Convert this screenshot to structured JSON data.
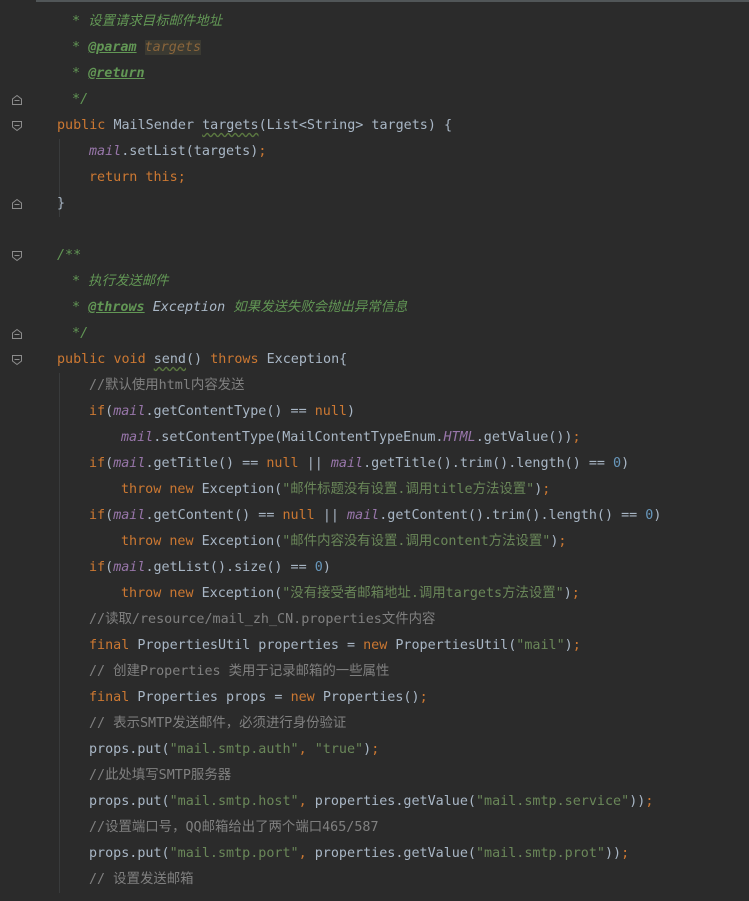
{
  "editor": {
    "lines": [
      {
        "tokens": [
          {
            "t": " * 设置请求目标邮件地址",
            "c": "t-doc"
          }
        ],
        "indent": 64
      },
      {
        "tokens": [
          {
            "t": " * ",
            "c": "t-doc"
          },
          {
            "t": "@param",
            "c": "t-doctag"
          },
          {
            "t": " ",
            "c": "t-doc"
          },
          {
            "t": "targets",
            "c": "t-docparam"
          }
        ],
        "indent": 64
      },
      {
        "tokens": [
          {
            "t": " * ",
            "c": "t-doc"
          },
          {
            "t": "@return",
            "c": "t-doctag"
          }
        ],
        "indent": 64
      },
      {
        "tokens": [
          {
            "t": " */",
            "c": "t-doc"
          }
        ],
        "indent": 64,
        "fold": "end"
      },
      {
        "tokens": [
          {
            "t": "public ",
            "c": "t-kw"
          },
          {
            "t": "MailSender ",
            "c": "t-type"
          },
          {
            "t": "targets",
            "c": "t-method t-typo"
          },
          {
            "t": "(List<String> targets) {",
            "c": "t-plain"
          }
        ],
        "indent": 57,
        "fold": "start"
      },
      {
        "tokens": [
          {
            "t": "mail",
            "c": "t-field"
          },
          {
            "t": ".setList(targets)",
            "c": "t-plain"
          },
          {
            "t": ";",
            "c": "t-semi"
          }
        ],
        "indent": 89
      },
      {
        "tokens": [
          {
            "t": "return ",
            "c": "t-kw"
          },
          {
            "t": "this",
            "c": "t-kw"
          },
          {
            "t": ";",
            "c": "t-semi"
          }
        ],
        "indent": 89
      },
      {
        "tokens": [
          {
            "t": "}",
            "c": "t-plain"
          }
        ],
        "indent": 57,
        "fold": "end"
      },
      {
        "tokens": [],
        "indent": 57
      },
      {
        "tokens": [
          {
            "t": "/**",
            "c": "t-doc"
          }
        ],
        "indent": 57,
        "fold": "start"
      },
      {
        "tokens": [
          {
            "t": " * 执行发送邮件",
            "c": "t-doc"
          }
        ],
        "indent": 64
      },
      {
        "tokens": [
          {
            "t": " * ",
            "c": "t-doc"
          },
          {
            "t": "@throws",
            "c": "t-doctag"
          },
          {
            "t": " ",
            "c": "t-doc"
          },
          {
            "t": "Exception",
            "c": "t-docref"
          },
          {
            "t": " 如果发送失败会抛出异常信息",
            "c": "t-doc"
          }
        ],
        "indent": 64
      },
      {
        "tokens": [
          {
            "t": " */",
            "c": "t-doc"
          }
        ],
        "indent": 64,
        "fold": "end"
      },
      {
        "tokens": [
          {
            "t": "public ",
            "c": "t-kw"
          },
          {
            "t": "void ",
            "c": "t-kw"
          },
          {
            "t": "send",
            "c": "t-method t-typo"
          },
          {
            "t": "() ",
            "c": "t-plain"
          },
          {
            "t": "throws ",
            "c": "t-kw"
          },
          {
            "t": "Exception{",
            "c": "t-plain"
          }
        ],
        "indent": 57,
        "fold": "start"
      },
      {
        "tokens": [
          {
            "t": "//默认使用html内容发送",
            "c": "t-comment"
          }
        ],
        "indent": 89
      },
      {
        "tokens": [
          {
            "t": "if",
            "c": "t-kw"
          },
          {
            "t": "(",
            "c": "t-plain"
          },
          {
            "t": "mail",
            "c": "t-field"
          },
          {
            "t": ".getContentType() == ",
            "c": "t-plain"
          },
          {
            "t": "null",
            "c": "t-kw"
          },
          {
            "t": ")",
            "c": "t-plain"
          }
        ],
        "indent": 89
      },
      {
        "tokens": [
          {
            "t": "mail",
            "c": "t-field"
          },
          {
            "t": ".setContentType(MailContentTypeEnum.",
            "c": "t-plain"
          },
          {
            "t": "HTML",
            "c": "t-const"
          },
          {
            "t": ".getValue())",
            "c": "t-plain"
          },
          {
            "t": ";",
            "c": "t-semi"
          }
        ],
        "indent": 121
      },
      {
        "tokens": [
          {
            "t": "if",
            "c": "t-kw"
          },
          {
            "t": "(",
            "c": "t-plain"
          },
          {
            "t": "mail",
            "c": "t-field"
          },
          {
            "t": ".getTitle() == ",
            "c": "t-plain"
          },
          {
            "t": "null ",
            "c": "t-kw"
          },
          {
            "t": "|| ",
            "c": "t-plain"
          },
          {
            "t": "mail",
            "c": "t-field"
          },
          {
            "t": ".getTitle().trim().length() == ",
            "c": "t-plain"
          },
          {
            "t": "0",
            "c": "t-num"
          },
          {
            "t": ")",
            "c": "t-plain"
          }
        ],
        "indent": 89
      },
      {
        "tokens": [
          {
            "t": "throw ",
            "c": "t-kw"
          },
          {
            "t": "new ",
            "c": "t-kw"
          },
          {
            "t": "Exception(",
            "c": "t-plain"
          },
          {
            "t": "\"邮件标题没有设置.调用title方法设置\"",
            "c": "t-str"
          },
          {
            "t": ")",
            "c": "t-plain"
          },
          {
            "t": ";",
            "c": "t-semi"
          }
        ],
        "indent": 121
      },
      {
        "tokens": [
          {
            "t": "if",
            "c": "t-kw"
          },
          {
            "t": "(",
            "c": "t-plain"
          },
          {
            "t": "mail",
            "c": "t-field"
          },
          {
            "t": ".getContent() == ",
            "c": "t-plain"
          },
          {
            "t": "null ",
            "c": "t-kw"
          },
          {
            "t": "|| ",
            "c": "t-plain"
          },
          {
            "t": "mail",
            "c": "t-field"
          },
          {
            "t": ".getContent().trim().length() == ",
            "c": "t-plain"
          },
          {
            "t": "0",
            "c": "t-num"
          },
          {
            "t": ")",
            "c": "t-plain"
          }
        ],
        "indent": 89
      },
      {
        "tokens": [
          {
            "t": "throw ",
            "c": "t-kw"
          },
          {
            "t": "new ",
            "c": "t-kw"
          },
          {
            "t": "Exception(",
            "c": "t-plain"
          },
          {
            "t": "\"邮件内容没有设置.调用content方法设置\"",
            "c": "t-str"
          },
          {
            "t": ")",
            "c": "t-plain"
          },
          {
            "t": ";",
            "c": "t-semi"
          }
        ],
        "indent": 121
      },
      {
        "tokens": [
          {
            "t": "if",
            "c": "t-kw"
          },
          {
            "t": "(",
            "c": "t-plain"
          },
          {
            "t": "mail",
            "c": "t-field"
          },
          {
            "t": ".getList().size() == ",
            "c": "t-plain"
          },
          {
            "t": "0",
            "c": "t-num"
          },
          {
            "t": ")",
            "c": "t-plain"
          }
        ],
        "indent": 89
      },
      {
        "tokens": [
          {
            "t": "throw ",
            "c": "t-kw"
          },
          {
            "t": "new ",
            "c": "t-kw"
          },
          {
            "t": "Exception(",
            "c": "t-plain"
          },
          {
            "t": "\"没有接受者邮箱地址.调用targets方法设置\"",
            "c": "t-str"
          },
          {
            "t": ")",
            "c": "t-plain"
          },
          {
            "t": ";",
            "c": "t-semi"
          }
        ],
        "indent": 121
      },
      {
        "tokens": [
          {
            "t": "//读取/resource/mail_zh_CN.properties文件内容",
            "c": "t-comment"
          }
        ],
        "indent": 89
      },
      {
        "tokens": [
          {
            "t": "final ",
            "c": "t-kw"
          },
          {
            "t": "PropertiesUtil properties = ",
            "c": "t-plain"
          },
          {
            "t": "new ",
            "c": "t-kw"
          },
          {
            "t": "PropertiesUtil(",
            "c": "t-plain"
          },
          {
            "t": "\"mail\"",
            "c": "t-str"
          },
          {
            "t": ")",
            "c": "t-plain"
          },
          {
            "t": ";",
            "c": "t-semi"
          }
        ],
        "indent": 89
      },
      {
        "tokens": [
          {
            "t": "// 创建Properties 类用于记录邮箱的一些属性",
            "c": "t-comment"
          }
        ],
        "indent": 89
      },
      {
        "tokens": [
          {
            "t": "final ",
            "c": "t-kw"
          },
          {
            "t": "Properties props = ",
            "c": "t-plain"
          },
          {
            "t": "new ",
            "c": "t-kw"
          },
          {
            "t": "Properties()",
            "c": "t-plain"
          },
          {
            "t": ";",
            "c": "t-semi"
          }
        ],
        "indent": 89
      },
      {
        "tokens": [
          {
            "t": "// 表示SMTP发送邮件，必须进行身份验证",
            "c": "t-comment"
          }
        ],
        "indent": 89
      },
      {
        "tokens": [
          {
            "t": "props.put(",
            "c": "t-plain"
          },
          {
            "t": "\"mail.smtp.auth\"",
            "c": "t-str"
          },
          {
            "t": ", ",
            "c": "t-semi"
          },
          {
            "t": "\"true\"",
            "c": "t-str"
          },
          {
            "t": ")",
            "c": "t-plain"
          },
          {
            "t": ";",
            "c": "t-semi"
          }
        ],
        "indent": 89
      },
      {
        "tokens": [
          {
            "t": "//此处填写SMTP服务器",
            "c": "t-comment"
          }
        ],
        "indent": 89
      },
      {
        "tokens": [
          {
            "t": "props.put(",
            "c": "t-plain"
          },
          {
            "t": "\"mail.smtp.host\"",
            "c": "t-str"
          },
          {
            "t": ", ",
            "c": "t-semi"
          },
          {
            "t": "properties.getValue(",
            "c": "t-plain"
          },
          {
            "t": "\"mail.smtp.service\"",
            "c": "t-str"
          },
          {
            "t": "))",
            "c": "t-plain"
          },
          {
            "t": ";",
            "c": "t-semi"
          }
        ],
        "indent": 89
      },
      {
        "tokens": [
          {
            "t": "//设置端口号，QQ邮箱给出了两个端口465/587",
            "c": "t-comment"
          }
        ],
        "indent": 89
      },
      {
        "tokens": [
          {
            "t": "props.put(",
            "c": "t-plain"
          },
          {
            "t": "\"mail.smtp.port\"",
            "c": "t-str"
          },
          {
            "t": ", ",
            "c": "t-semi"
          },
          {
            "t": "properties.getValue(",
            "c": "t-plain"
          },
          {
            "t": "\"mail.smtp.prot\"",
            "c": "t-str"
          },
          {
            "t": "))",
            "c": "t-plain"
          },
          {
            "t": ";",
            "c": "t-semi"
          }
        ],
        "indent": 89
      },
      {
        "tokens": [
          {
            "t": "// 设置发送邮箱",
            "c": "t-comment"
          }
        ],
        "indent": 89
      }
    ]
  }
}
